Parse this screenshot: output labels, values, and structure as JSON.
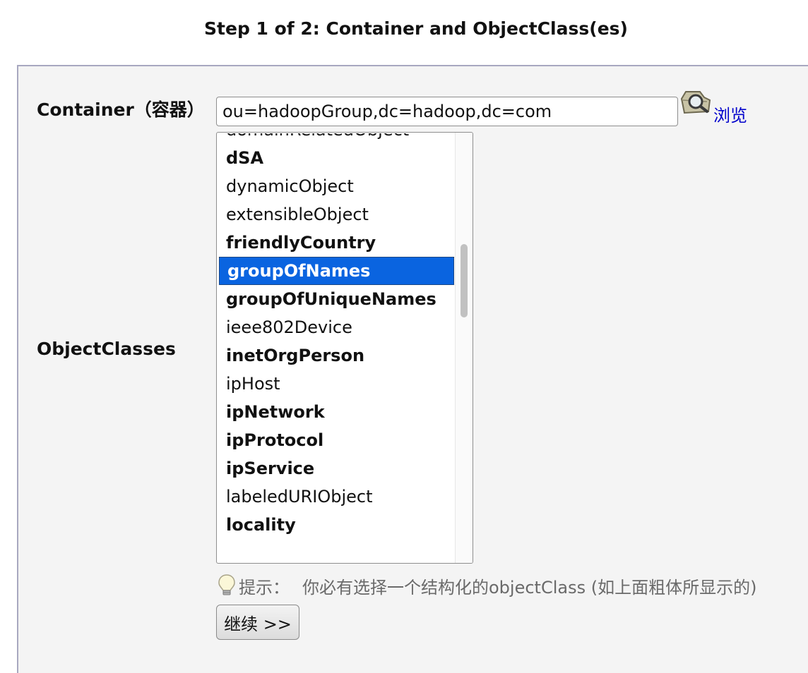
{
  "page": {
    "title": "Step 1 of 2: Container and ObjectClass(es)"
  },
  "form": {
    "container_label": "Container（容器）",
    "container_value": "ou=hadoopGroup,dc=hadoop,dc=com",
    "browse_icon": "magnifier-icon",
    "browse_label": "浏览",
    "objectclasses_label": "ObjectClasses",
    "objectclasses": [
      {
        "name": "domainRelatedObject",
        "structural": false
      },
      {
        "name": "dSA",
        "structural": true
      },
      {
        "name": "dynamicObject",
        "structural": false
      },
      {
        "name": "extensibleObject",
        "structural": false
      },
      {
        "name": "friendlyCountry",
        "structural": true
      },
      {
        "name": "groupOfNames",
        "structural": true,
        "selected": true
      },
      {
        "name": "groupOfUniqueNames",
        "structural": true
      },
      {
        "name": "ieee802Device",
        "structural": false
      },
      {
        "name": "inetOrgPerson",
        "structural": true
      },
      {
        "name": "ipHost",
        "structural": false
      },
      {
        "name": "ipNetwork",
        "structural": true
      },
      {
        "name": "ipProtocol",
        "structural": true
      },
      {
        "name": "ipService",
        "structural": true
      },
      {
        "name": "labeledURIObject",
        "structural": false
      },
      {
        "name": "locality",
        "structural": true
      }
    ],
    "hint_icon": "lightbulb-icon",
    "hint_label": "提示：",
    "hint_text": "你必有选择一个结构化的objectClass (如上面粗体所显示的)",
    "continue_label": "继续 >>"
  },
  "colors": {
    "selected_bg": "#0a64e0",
    "link": "#0000cc",
    "frame_bg": "#f4f4f4",
    "frame_border": "#a8a8c0"
  }
}
